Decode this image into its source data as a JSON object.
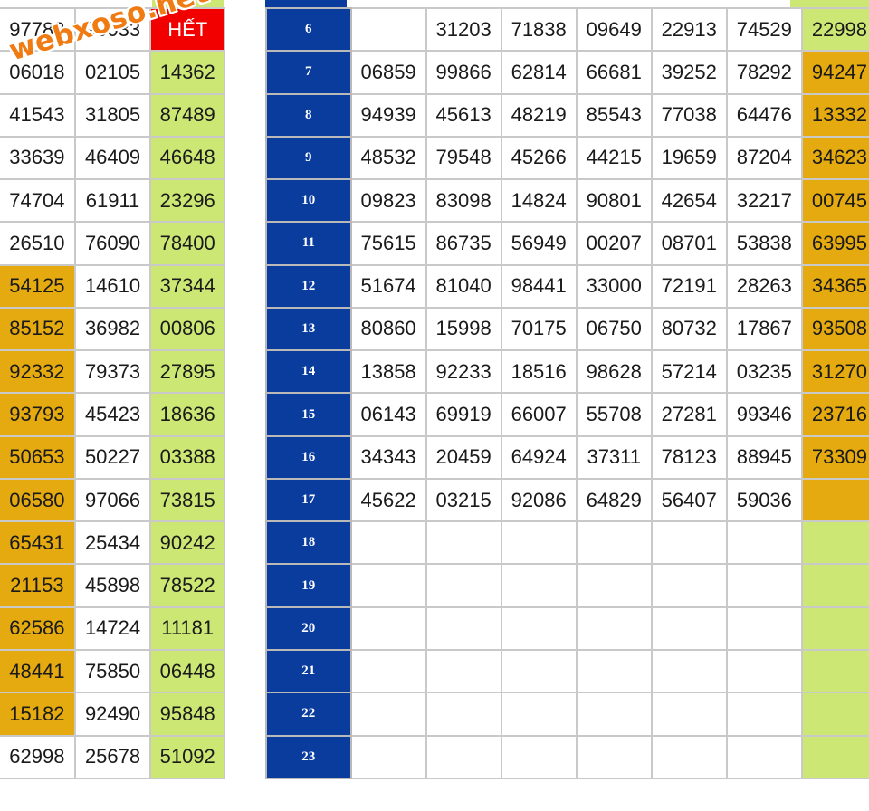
{
  "watermark": "webxoso.net",
  "left_table": {
    "rows": [
      [
        "97783",
        "90033",
        "HẾT"
      ],
      [
        "06018",
        "02105",
        "14362"
      ],
      [
        "41543",
        "31805",
        "87489"
      ],
      [
        "33639",
        "46409",
        "46648"
      ],
      [
        "74704",
        "61911",
        "23296"
      ],
      [
        "26510",
        "76090",
        "78400"
      ],
      [
        "54125",
        "14610",
        "37344"
      ],
      [
        "85152",
        "36982",
        "00806"
      ],
      [
        "92332",
        "79373",
        "27895"
      ],
      [
        "93793",
        "45423",
        "18636"
      ],
      [
        "50653",
        "50227",
        "03388"
      ],
      [
        "06580",
        "97066",
        "73815"
      ],
      [
        "65431",
        "25434",
        "90242"
      ],
      [
        "21153",
        "45898",
        "78522"
      ],
      [
        "62586",
        "14724",
        "11181"
      ],
      [
        "48441",
        "75850",
        "06448"
      ],
      [
        "15182",
        "92490",
        "95848"
      ],
      [
        "62998",
        "25678",
        "51092"
      ]
    ]
  },
  "right_table": {
    "rows": [
      {
        "day": "6",
        "values": [
          "",
          "31203",
          "71838",
          "09649",
          "22913",
          "74529",
          "22998"
        ]
      },
      {
        "day": "7",
        "values": [
          "06859",
          "99866",
          "62814",
          "66681",
          "39252",
          "78292",
          "94247"
        ]
      },
      {
        "day": "8",
        "values": [
          "94939",
          "45613",
          "48219",
          "85543",
          "77038",
          "64476",
          "13332"
        ]
      },
      {
        "day": "9",
        "values": [
          "48532",
          "79548",
          "45266",
          "44215",
          "19659",
          "87204",
          "34623"
        ]
      },
      {
        "day": "10",
        "values": [
          "09823",
          "83098",
          "14824",
          "90801",
          "42654",
          "32217",
          "00745"
        ]
      },
      {
        "day": "11",
        "values": [
          "75615",
          "86735",
          "56949",
          "00207",
          "08701",
          "53838",
          "63995"
        ]
      },
      {
        "day": "12",
        "values": [
          "51674",
          "81040",
          "98441",
          "33000",
          "72191",
          "28263",
          "34365"
        ]
      },
      {
        "day": "13",
        "values": [
          "80860",
          "15998",
          "70175",
          "06750",
          "80732",
          "17867",
          "93508"
        ]
      },
      {
        "day": "14",
        "values": [
          "13858",
          "92233",
          "18516",
          "98628",
          "57214",
          "03235",
          "31270"
        ]
      },
      {
        "day": "15",
        "values": [
          "06143",
          "69919",
          "66007",
          "55708",
          "27281",
          "99346",
          "23716"
        ]
      },
      {
        "day": "16",
        "values": [
          "34343",
          "20459",
          "64924",
          "37311",
          "78123",
          "88945",
          "73309"
        ]
      },
      {
        "day": "17",
        "values": [
          "45622",
          "03215",
          "92086",
          "64829",
          "56407",
          "59036",
          ""
        ]
      },
      {
        "day": "18",
        "values": [
          "",
          "",
          "",
          "",
          "",
          "",
          ""
        ]
      },
      {
        "day": "19",
        "values": [
          "",
          "",
          "",
          "",
          "",
          "",
          ""
        ]
      },
      {
        "day": "20",
        "values": [
          "",
          "",
          "",
          "",
          "",
          "",
          ""
        ]
      },
      {
        "day": "21",
        "values": [
          "",
          "",
          "",
          "",
          "",
          "",
          ""
        ]
      },
      {
        "day": "22",
        "values": [
          "",
          "",
          "",
          "",
          "",
          "",
          ""
        ]
      },
      {
        "day": "23",
        "values": [
          "",
          "",
          "",
          "",
          "",
          "",
          ""
        ]
      }
    ]
  },
  "colors": {
    "green": "#cce774",
    "orange": "#e4aa0f",
    "red": "#f20000",
    "day_blue": "#0a3c9e",
    "grid": "#c9c9c9"
  }
}
